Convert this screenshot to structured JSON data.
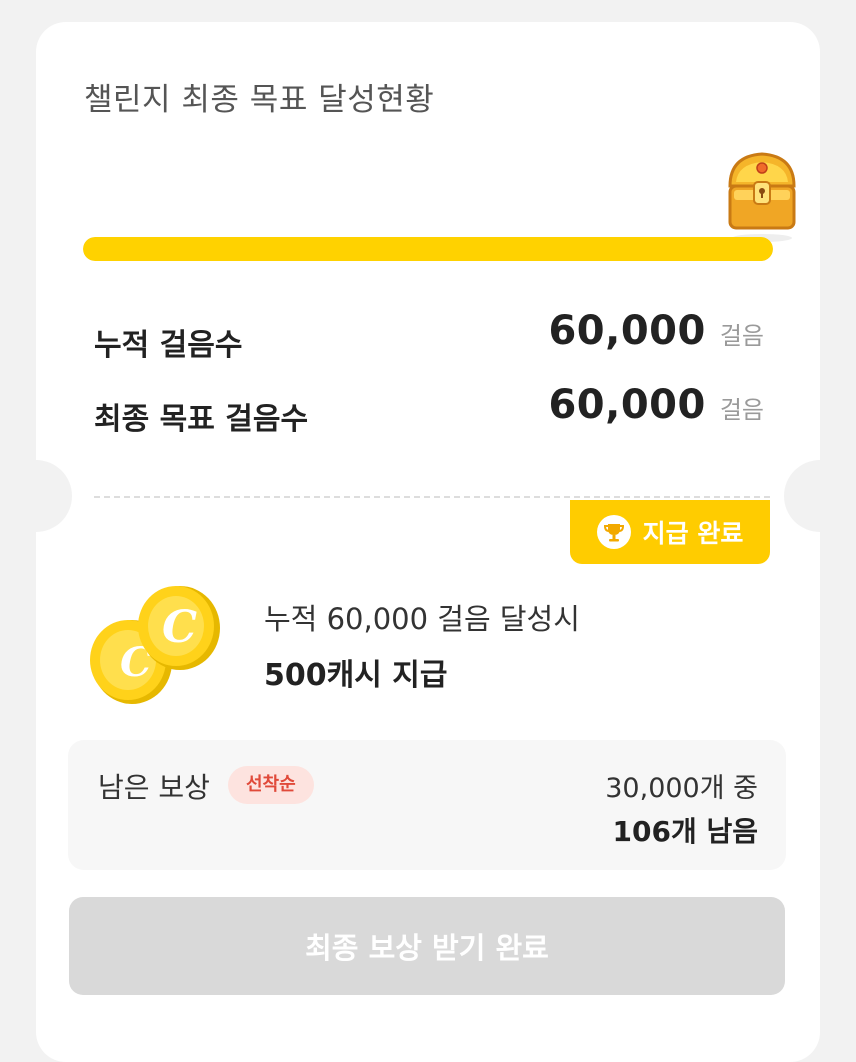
{
  "title": "챌린지 최종 목표 달성현황",
  "progress": {
    "value": 1.0,
    "color": "#ffd200"
  },
  "stats": [
    {
      "label": "누적 걸음수",
      "value": "60,000",
      "unit": "걸음"
    },
    {
      "label": "최종 목표 걸음수",
      "value": "60,000",
      "unit": "걸음"
    }
  ],
  "badge": {
    "icon": "trophy-icon",
    "label": "지급 완료"
  },
  "reward": {
    "icon": "coins-icon",
    "condition": "누적 60,000 걸음 달성시",
    "amount": "500캐시 지급"
  },
  "remaining": {
    "label": "남은 보상",
    "tag": "선착순",
    "total": "30,000개 중",
    "left": "106개 남음"
  },
  "claim_button": {
    "label": "최종 보상 받기 완료",
    "state": "disabled"
  },
  "colors": {
    "accent": "#ffcc00",
    "tag_text": "#e04a3a",
    "disabled": "#d9d9d9"
  },
  "chest_icon": "treasure-chest-icon"
}
